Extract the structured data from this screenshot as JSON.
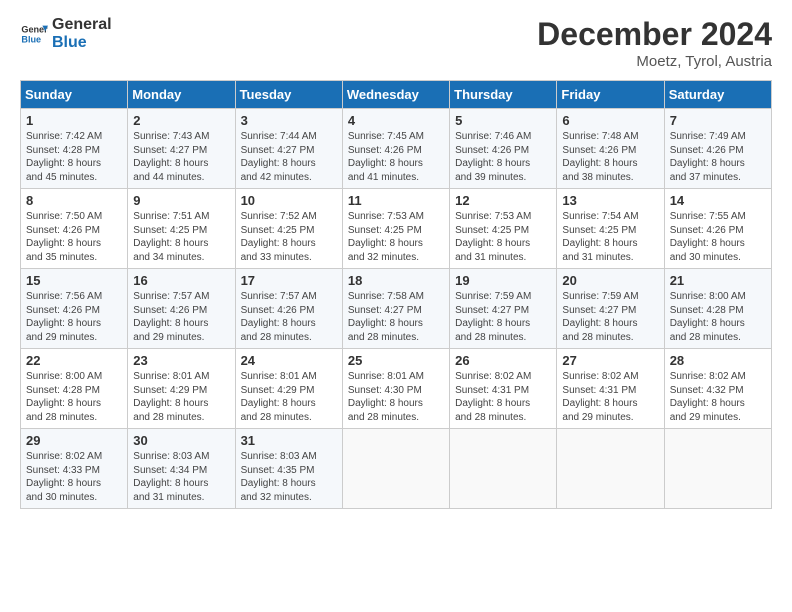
{
  "logo": {
    "line1": "General",
    "line2": "Blue"
  },
  "title": "December 2024",
  "location": "Moetz, Tyrol, Austria",
  "days_of_week": [
    "Sunday",
    "Monday",
    "Tuesday",
    "Wednesday",
    "Thursday",
    "Friday",
    "Saturday"
  ],
  "weeks": [
    [
      {
        "day": "1",
        "lines": [
          "Sunrise: 7:42 AM",
          "Sunset: 4:28 PM",
          "Daylight: 8 hours",
          "and 45 minutes."
        ]
      },
      {
        "day": "2",
        "lines": [
          "Sunrise: 7:43 AM",
          "Sunset: 4:27 PM",
          "Daylight: 8 hours",
          "and 44 minutes."
        ]
      },
      {
        "day": "3",
        "lines": [
          "Sunrise: 7:44 AM",
          "Sunset: 4:27 PM",
          "Daylight: 8 hours",
          "and 42 minutes."
        ]
      },
      {
        "day": "4",
        "lines": [
          "Sunrise: 7:45 AM",
          "Sunset: 4:26 PM",
          "Daylight: 8 hours",
          "and 41 minutes."
        ]
      },
      {
        "day": "5",
        "lines": [
          "Sunrise: 7:46 AM",
          "Sunset: 4:26 PM",
          "Daylight: 8 hours",
          "and 39 minutes."
        ]
      },
      {
        "day": "6",
        "lines": [
          "Sunrise: 7:48 AM",
          "Sunset: 4:26 PM",
          "Daylight: 8 hours",
          "and 38 minutes."
        ]
      },
      {
        "day": "7",
        "lines": [
          "Sunrise: 7:49 AM",
          "Sunset: 4:26 PM",
          "Daylight: 8 hours",
          "and 37 minutes."
        ]
      }
    ],
    [
      {
        "day": "8",
        "lines": [
          "Sunrise: 7:50 AM",
          "Sunset: 4:26 PM",
          "Daylight: 8 hours",
          "and 35 minutes."
        ]
      },
      {
        "day": "9",
        "lines": [
          "Sunrise: 7:51 AM",
          "Sunset: 4:25 PM",
          "Daylight: 8 hours",
          "and 34 minutes."
        ]
      },
      {
        "day": "10",
        "lines": [
          "Sunrise: 7:52 AM",
          "Sunset: 4:25 PM",
          "Daylight: 8 hours",
          "and 33 minutes."
        ]
      },
      {
        "day": "11",
        "lines": [
          "Sunrise: 7:53 AM",
          "Sunset: 4:25 PM",
          "Daylight: 8 hours",
          "and 32 minutes."
        ]
      },
      {
        "day": "12",
        "lines": [
          "Sunrise: 7:53 AM",
          "Sunset: 4:25 PM",
          "Daylight: 8 hours",
          "and 31 minutes."
        ]
      },
      {
        "day": "13",
        "lines": [
          "Sunrise: 7:54 AM",
          "Sunset: 4:25 PM",
          "Daylight: 8 hours",
          "and 31 minutes."
        ]
      },
      {
        "day": "14",
        "lines": [
          "Sunrise: 7:55 AM",
          "Sunset: 4:26 PM",
          "Daylight: 8 hours",
          "and 30 minutes."
        ]
      }
    ],
    [
      {
        "day": "15",
        "lines": [
          "Sunrise: 7:56 AM",
          "Sunset: 4:26 PM",
          "Daylight: 8 hours",
          "and 29 minutes."
        ]
      },
      {
        "day": "16",
        "lines": [
          "Sunrise: 7:57 AM",
          "Sunset: 4:26 PM",
          "Daylight: 8 hours",
          "and 29 minutes."
        ]
      },
      {
        "day": "17",
        "lines": [
          "Sunrise: 7:57 AM",
          "Sunset: 4:26 PM",
          "Daylight: 8 hours",
          "and 28 minutes."
        ]
      },
      {
        "day": "18",
        "lines": [
          "Sunrise: 7:58 AM",
          "Sunset: 4:27 PM",
          "Daylight: 8 hours",
          "and 28 minutes."
        ]
      },
      {
        "day": "19",
        "lines": [
          "Sunrise: 7:59 AM",
          "Sunset: 4:27 PM",
          "Daylight: 8 hours",
          "and 28 minutes."
        ]
      },
      {
        "day": "20",
        "lines": [
          "Sunrise: 7:59 AM",
          "Sunset: 4:27 PM",
          "Daylight: 8 hours",
          "and 28 minutes."
        ]
      },
      {
        "day": "21",
        "lines": [
          "Sunrise: 8:00 AM",
          "Sunset: 4:28 PM",
          "Daylight: 8 hours",
          "and 28 minutes."
        ]
      }
    ],
    [
      {
        "day": "22",
        "lines": [
          "Sunrise: 8:00 AM",
          "Sunset: 4:28 PM",
          "Daylight: 8 hours",
          "and 28 minutes."
        ]
      },
      {
        "day": "23",
        "lines": [
          "Sunrise: 8:01 AM",
          "Sunset: 4:29 PM",
          "Daylight: 8 hours",
          "and 28 minutes."
        ]
      },
      {
        "day": "24",
        "lines": [
          "Sunrise: 8:01 AM",
          "Sunset: 4:29 PM",
          "Daylight: 8 hours",
          "and 28 minutes."
        ]
      },
      {
        "day": "25",
        "lines": [
          "Sunrise: 8:01 AM",
          "Sunset: 4:30 PM",
          "Daylight: 8 hours",
          "and 28 minutes."
        ]
      },
      {
        "day": "26",
        "lines": [
          "Sunrise: 8:02 AM",
          "Sunset: 4:31 PM",
          "Daylight: 8 hours",
          "and 28 minutes."
        ]
      },
      {
        "day": "27",
        "lines": [
          "Sunrise: 8:02 AM",
          "Sunset: 4:31 PM",
          "Daylight: 8 hours",
          "and 29 minutes."
        ]
      },
      {
        "day": "28",
        "lines": [
          "Sunrise: 8:02 AM",
          "Sunset: 4:32 PM",
          "Daylight: 8 hours",
          "and 29 minutes."
        ]
      }
    ],
    [
      {
        "day": "29",
        "lines": [
          "Sunrise: 8:02 AM",
          "Sunset: 4:33 PM",
          "Daylight: 8 hours",
          "and 30 minutes."
        ]
      },
      {
        "day": "30",
        "lines": [
          "Sunrise: 8:03 AM",
          "Sunset: 4:34 PM",
          "Daylight: 8 hours",
          "and 31 minutes."
        ]
      },
      {
        "day": "31",
        "lines": [
          "Sunrise: 8:03 AM",
          "Sunset: 4:35 PM",
          "Daylight: 8 hours",
          "and 32 minutes."
        ]
      },
      null,
      null,
      null,
      null
    ]
  ]
}
